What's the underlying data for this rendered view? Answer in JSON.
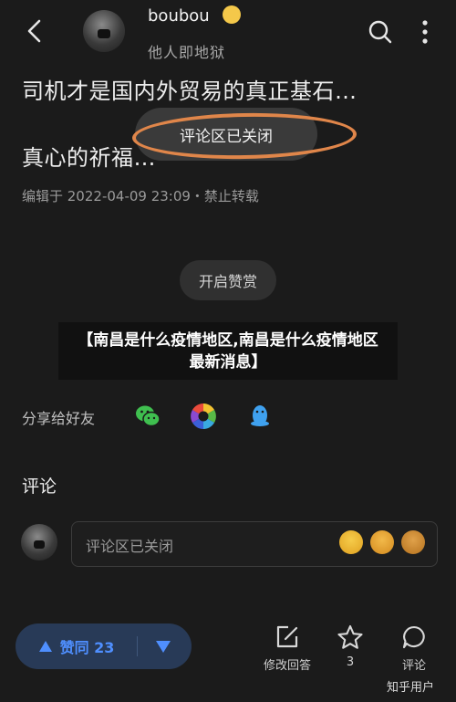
{
  "header": {
    "username": "boubou",
    "subtitle": "他人即地狱"
  },
  "content": {
    "line1": "司机才是国内外贸易的真正基石…",
    "line2": "真心的祈福…",
    "meta": "编辑于 2022-04-09 23:09・禁止转载"
  },
  "toast": {
    "text": "评论区已关闭"
  },
  "reward": {
    "label": "开启赞赏"
  },
  "banner": {
    "text": "【南昌是什么疫情地区,南昌是什么疫情地区最新消息】"
  },
  "share": {
    "label": "分享给好友"
  },
  "comments": {
    "title": "评论",
    "placeholder": "评论区已关闭"
  },
  "bottom_bar": {
    "vote_label": "赞同 23",
    "actions": [
      {
        "label": "修改回答"
      },
      {
        "label": "3"
      },
      {
        "label": "评论"
      }
    ]
  },
  "watermark": "知乎用户",
  "colors": {
    "accent": "#4f8fff",
    "highlight": "#e0864a",
    "background": "#1b1b1b"
  }
}
